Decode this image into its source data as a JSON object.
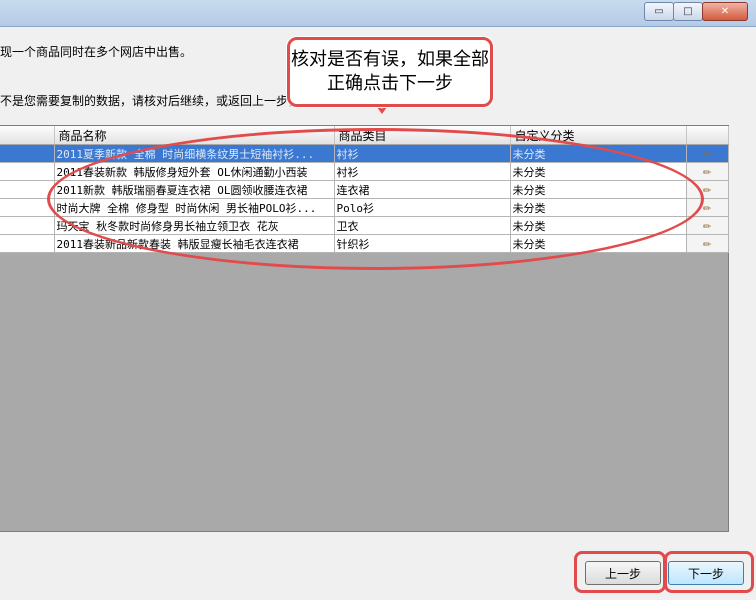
{
  "window": {
    "buttons": {
      "minimize": "▭",
      "maximize": "□",
      "close": "✕"
    }
  },
  "intro_text": "现一个商品同时在多个网店中出售。",
  "notice_text": "不是您需要复制的数据，请核对后继续，或返回上一步修",
  "table": {
    "headers": [
      "",
      "商品名称",
      "商品类目",
      "自定义分类",
      ""
    ],
    "rows": [
      {
        "id": "",
        "name": "2011夏季新款 全棉 时尚细横条纹男士短袖衬衫...",
        "category": "衬衫",
        "custom": "未分类",
        "selected": true
      },
      {
        "id": "",
        "name": "2011春装新款 韩版修身短外套 OL休闲通勤小西装",
        "category": "衬衫",
        "custom": "未分类",
        "selected": false
      },
      {
        "id": "",
        "name": "2011新款 韩版瑞丽春夏连衣裙 OL圆领收腰连衣裙",
        "category": "连衣裙",
        "custom": "未分类",
        "selected": false
      },
      {
        "id": "",
        "name": "时尚大牌 全棉 修身型 时尚休闲 男长袖POLO衫...",
        "category": "Polo衫",
        "custom": "未分类",
        "selected": false
      },
      {
        "id": "",
        "name": "玛天宝 秋冬款时尚修身男长袖立领卫衣 花灰",
        "category": "卫衣",
        "custom": "未分类",
        "selected": false
      },
      {
        "id": "",
        "name": "2011春装新品新款春装 韩版显瘦长袖毛衣连衣裙",
        "category": "针织衫",
        "custom": "未分类",
        "selected": false
      }
    ]
  },
  "callout_text": "核对是否有误，如果全部正确点击下一步",
  "footer": {
    "prev": "上一步",
    "next": "下一步"
  },
  "colors": {
    "annotation": "#e24b4b",
    "selection": "#3a78d1"
  }
}
